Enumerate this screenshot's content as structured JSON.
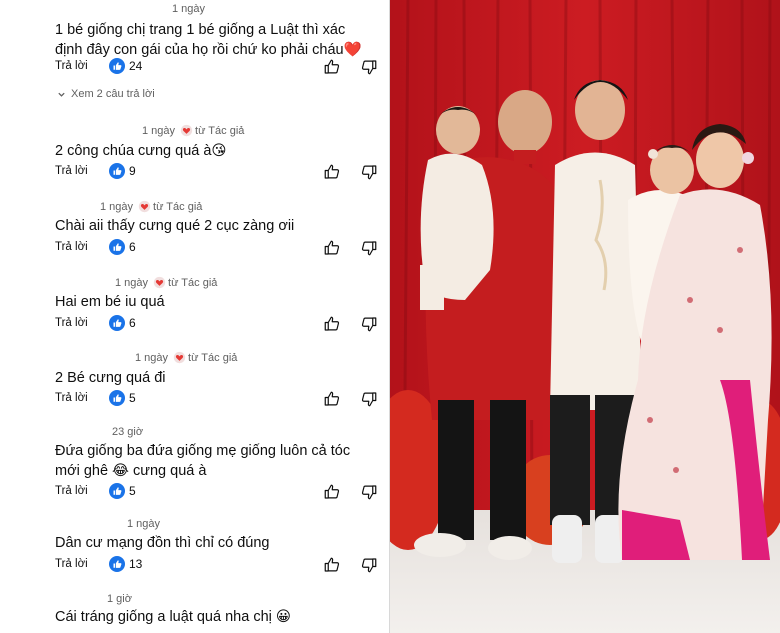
{
  "comments": [
    {
      "meta": "1 ngày",
      "author_heart": false,
      "text": "1 bé giống chị trang 1 bé giống a Luật thì xác định đây con gái của họ rồi chứ ko phải cháu❤️",
      "reply_label": "Trả lời",
      "likes": "24"
    },
    {
      "meta": "1 ngày",
      "author_heart": true,
      "author_label": "từ Tác giả",
      "text": "2 công chúa cưng quá à😘",
      "reply_label": "Trả lời",
      "likes": "9"
    },
    {
      "meta": "1 ngày",
      "author_heart": true,
      "author_label": "từ Tác giả",
      "text": "Chài aii thấy cưng qué 2 cục zàng ơii",
      "reply_label": "Trả lời",
      "likes": "6"
    },
    {
      "meta": "1 ngày",
      "author_heart": true,
      "author_label": "từ Tác giả",
      "text": "Hai em bé iu quá",
      "reply_label": "Trả lời",
      "likes": "6"
    },
    {
      "meta": "1 ngày",
      "author_heart": true,
      "author_label": "từ Tác giả",
      "text": "2 Bé cưng quá đi",
      "reply_label": "Trả lời",
      "likes": "5"
    },
    {
      "meta": "23 giờ",
      "author_heart": false,
      "text": "Đứa giống ba đứa giống mẹ giống luôn cả tóc mới ghê 😂 cưng quá à",
      "reply_label": "Trả lời",
      "likes": "5"
    },
    {
      "meta": "1 ngày",
      "author_heart": false,
      "text": "Dân cư mạng đồn thì chỉ có đúng",
      "reply_label": "Trả lời",
      "likes": "13"
    },
    {
      "meta": "1 giờ",
      "author_heart": false,
      "text": "Cái tráng giống a luật quá nha chị 😀",
      "reply_label": "",
      "likes": ""
    }
  ],
  "view_replies": "Xem 2 câu trả lời",
  "icons": {
    "like": "like-icon",
    "thumb_up": "thumbs-up-icon",
    "thumb_down": "thumbs-down-icon",
    "heart": "creator-heart-icon",
    "chevron": "chevron-down-icon"
  },
  "colors": {
    "like_blue": "#1a73e8",
    "heart_red": "#e53935",
    "curtain_red": "#c8151b"
  }
}
